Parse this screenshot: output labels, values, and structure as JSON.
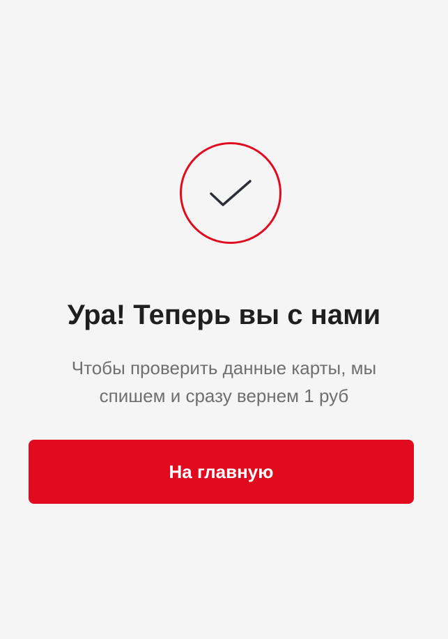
{
  "success": {
    "icon": "checkmark-icon",
    "circle_color": "#e00b1e",
    "check_color": "#2b2e36"
  },
  "title": "Ура! Теперь вы с нами",
  "subtitle_line1": "Чтобы проверить данные карты, мы",
  "subtitle_line2": "спишем и сразу вернем 1 руб",
  "home_button": {
    "label": "На главную",
    "color": "#e00b1e"
  }
}
